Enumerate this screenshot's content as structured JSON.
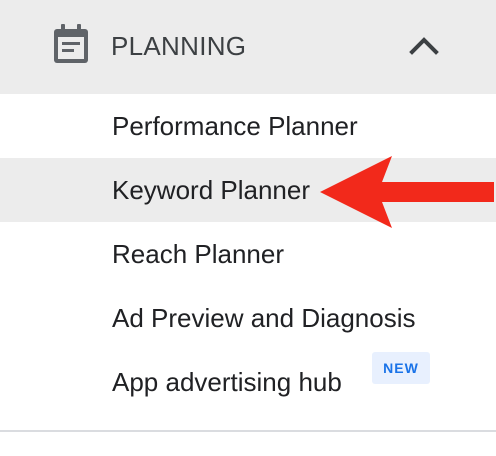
{
  "section": {
    "title": "PLANNING",
    "icon": "calendar-icon",
    "toggle_icon": "chevron-up-icon",
    "expanded": true
  },
  "menu": {
    "items": [
      {
        "label": "Performance Planner",
        "active": false
      },
      {
        "label": "Keyword Planner",
        "active": true
      },
      {
        "label": "Reach Planner",
        "active": false
      },
      {
        "label": "Ad Preview and Diagnosis",
        "active": false
      },
      {
        "label": "App advertising hub",
        "active": false,
        "badge": "NEW"
      }
    ]
  },
  "annotation": {
    "type": "arrow",
    "color": "#f2291b",
    "points_to": "Keyword Planner"
  },
  "colors": {
    "header_bg": "#ececec",
    "active_bg": "#ececec",
    "badge_bg": "#e8f0fe",
    "badge_text": "#1a73e8"
  }
}
